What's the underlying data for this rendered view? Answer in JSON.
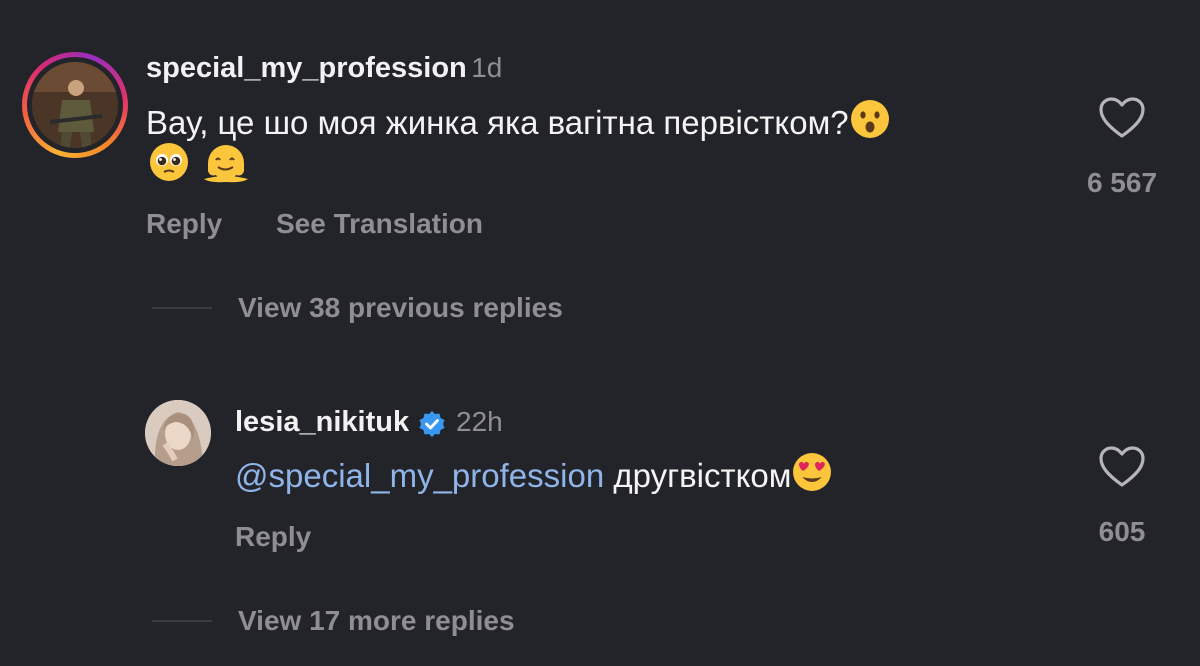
{
  "comments": [
    {
      "username": "special_my_profession",
      "time": "1d",
      "text": "Вау, це шо моя жинка яка вагітна первістком?",
      "emojis": [
        "hushed-face-emoji",
        "pleading-face-emoji",
        "melting-face-emoji"
      ],
      "reply_label": "Reply",
      "translate_label": "See Translation",
      "like_count": "6 567",
      "view_replies_label": "View 38 previous replies"
    },
    {
      "username": "lesia_nikituk",
      "verified": true,
      "time": "22h",
      "mention": "@special_my_profession",
      "text": "другвістком",
      "emojis": [
        "heart-eyes-emoji"
      ],
      "reply_label": "Reply",
      "like_count": "605",
      "view_replies_label": "View 17 more replies"
    }
  ],
  "colors": {
    "background": "#232429",
    "text": "#f4f4f4",
    "muted": "#8e8e93",
    "mention": "#8fb4e8",
    "verified": "#3897f0"
  }
}
